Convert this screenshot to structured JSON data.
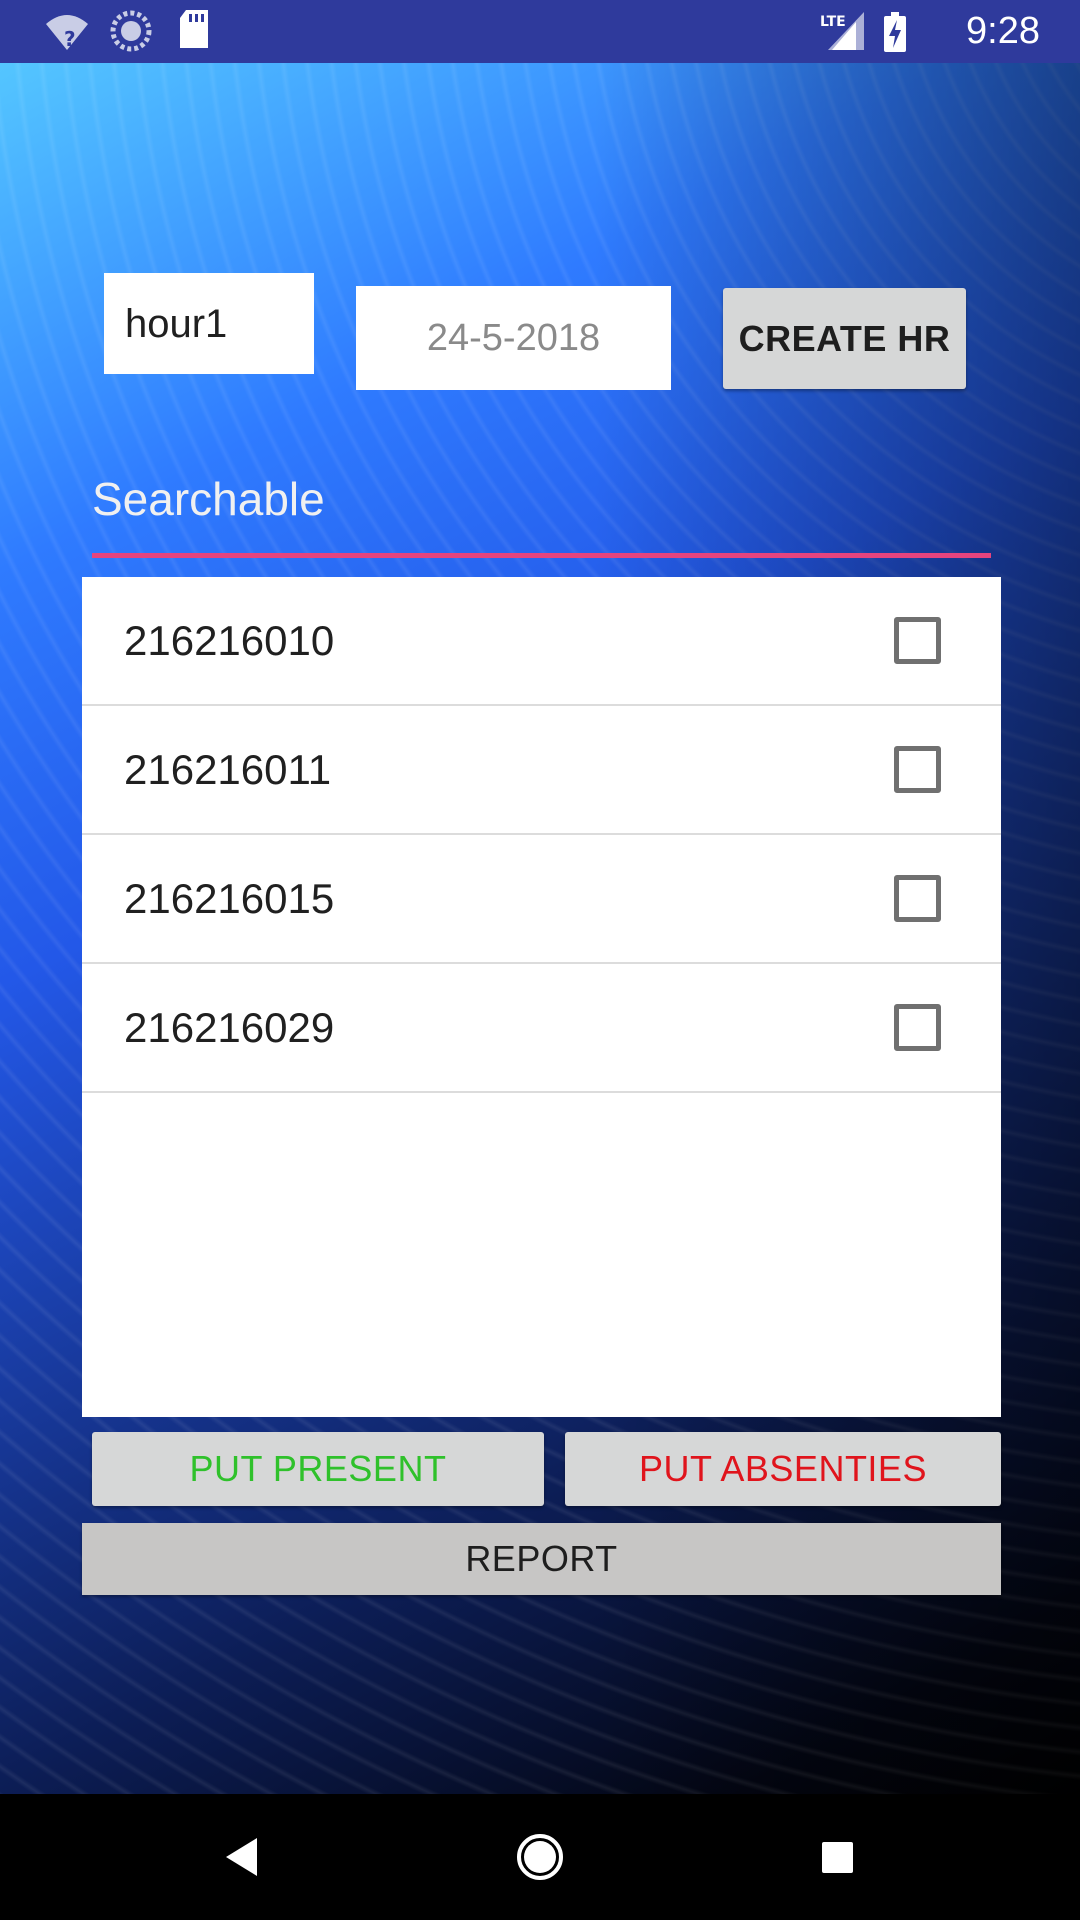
{
  "status_bar": {
    "time": "9:28",
    "network": "LTE",
    "icons": [
      "wifi-unknown-icon",
      "sync-icon",
      "sd-card-icon",
      "signal-icon",
      "battery-charging-icon"
    ]
  },
  "form": {
    "hour_value": "hour1",
    "date_value": "24-5-2018",
    "create_button_label": "CREATE HR"
  },
  "search": {
    "text": "Searchable",
    "underline_color": "#e6447e"
  },
  "list": {
    "items": [
      {
        "label": "216216010",
        "checked": false
      },
      {
        "label": "216216011",
        "checked": false
      },
      {
        "label": "216216015",
        "checked": false
      },
      {
        "label": "216216029",
        "checked": false
      }
    ]
  },
  "actions": {
    "present_label": "PUT PRESENT",
    "present_color": "#2fc12b",
    "absent_label": "PUT ABSENTIES",
    "absent_color": "#e0141c",
    "report_label": "REPORT"
  },
  "nav_bar": {
    "icons": [
      "back-icon",
      "home-icon",
      "recents-icon"
    ]
  }
}
